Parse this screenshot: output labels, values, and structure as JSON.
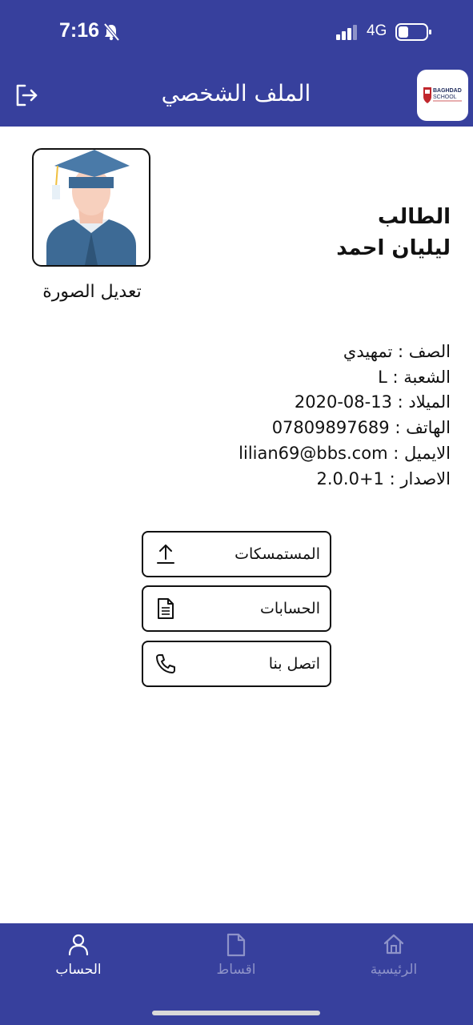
{
  "status_bar": {
    "time": "7:16",
    "network": "4G"
  },
  "header": {
    "title": "الملف الشخصي"
  },
  "profile": {
    "edit_photo": "تعديل الصورة",
    "role": "الطالب",
    "name": "ليليان احمد"
  },
  "info": {
    "grade": "الصف : تمهيدي",
    "section": "الشعبة : L",
    "birth": "الميلاد : 13-08-2020",
    "phone": "الهاتف : 07809897689",
    "email": "الايميل : lilian69@bbs.com",
    "version": "الاصدار : 1+2.0.0"
  },
  "actions": {
    "documents": "المستمسكات",
    "accounts": "الحسابات",
    "contact": "اتصل بنا"
  },
  "bottom_nav": {
    "account": "الحساب",
    "installments": "اقساط",
    "home": "الرئيسية"
  },
  "logo": {
    "line1": "BAGHDAD",
    "line2": "SCHOOL"
  },
  "colors": {
    "primary": "#37409d",
    "nav_active": "#ffffff",
    "nav_inactive": "#8e93c9"
  },
  "icons": [
    "bell-slash-icon",
    "signal-icon",
    "battery-icon",
    "logout-icon",
    "graduate-avatar",
    "upload-icon",
    "document-icon",
    "phone-icon",
    "user-icon",
    "file-icon",
    "home-icon"
  ]
}
